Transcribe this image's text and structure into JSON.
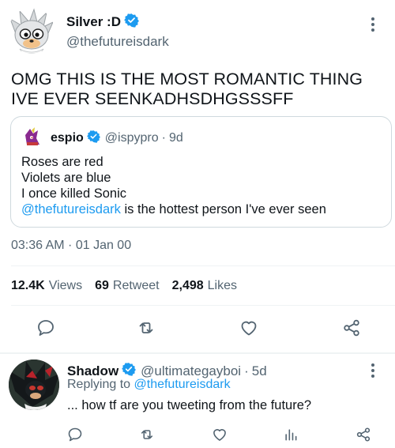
{
  "main_tweet": {
    "author": {
      "display_name": "Silver :D",
      "handle": "@thefutureisdark",
      "verified": true
    },
    "text": "OMG THIS IS THE MOST ROMANTIC THING IVE EVER SEENKADHSDHGSSSFF",
    "quoted_tweet": {
      "author": {
        "display_name": "espio",
        "handle": "@ispypro",
        "verified": true
      },
      "separator": "·",
      "time": "9d",
      "lines": [
        "Roses are red",
        "Violets are blue",
        "I once killed Sonic"
      ],
      "last_line_mention": "@thefutureisdark",
      "last_line_rest": " is the hottest person I've ever seen"
    },
    "timestamp": "03:36 AM · 01 Jan 00",
    "stats": {
      "views_count": "12.4K",
      "views_label": "Views",
      "retweet_count": "69",
      "retweet_label": "Retweet",
      "likes_count": "2,498",
      "likes_label": "Likes"
    },
    "actions": [
      "reply-icon",
      "retweet-icon",
      "like-icon",
      "share-icon"
    ]
  },
  "reply_tweet": {
    "author": {
      "display_name": "Shadow",
      "handle": "@ultimategayboi",
      "verified": true
    },
    "separator": "·",
    "time": "5d",
    "replying_prefix": "Replying to ",
    "replying_handle": "@thefutureisdark",
    "text": "... how tf are you tweeting from the future?",
    "actions": [
      "reply-icon",
      "retweet-icon",
      "like-icon",
      "analytics-icon",
      "share-icon"
    ]
  },
  "colors": {
    "accent": "#1d9bf0",
    "text_primary": "#0f1419",
    "text_secondary": "#536471",
    "border": "#cfd9de",
    "divider": "#eff3f4"
  }
}
